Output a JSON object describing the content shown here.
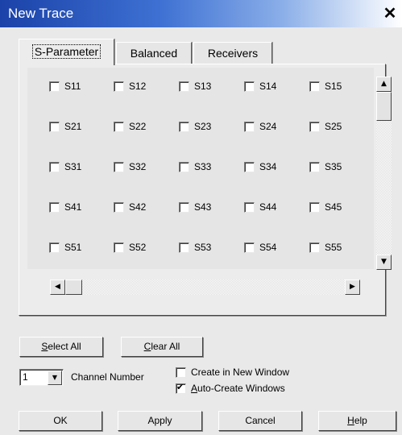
{
  "window": {
    "title": "New Trace",
    "close_glyph": "✕"
  },
  "tabs": [
    {
      "label": "S-Parameter",
      "active": true
    },
    {
      "label": "Balanced",
      "active": false
    },
    {
      "label": "Receivers",
      "active": false
    }
  ],
  "sparams": {
    "rows": [
      [
        {
          "label": "S11",
          "checked": false
        },
        {
          "label": "S12",
          "checked": false
        },
        {
          "label": "S13",
          "checked": false
        },
        {
          "label": "S14",
          "checked": false
        },
        {
          "label": "S15",
          "checked": false
        }
      ],
      [
        {
          "label": "S21",
          "checked": false
        },
        {
          "label": "S22",
          "checked": false
        },
        {
          "label": "S23",
          "checked": false
        },
        {
          "label": "S24",
          "checked": false
        },
        {
          "label": "S25",
          "checked": false
        }
      ],
      [
        {
          "label": "S31",
          "checked": false
        },
        {
          "label": "S32",
          "checked": false
        },
        {
          "label": "S33",
          "checked": false
        },
        {
          "label": "S34",
          "checked": false
        },
        {
          "label": "S35",
          "checked": false
        }
      ],
      [
        {
          "label": "S41",
          "checked": false
        },
        {
          "label": "S42",
          "checked": false
        },
        {
          "label": "S43",
          "checked": false
        },
        {
          "label": "S44",
          "checked": false
        },
        {
          "label": "S45",
          "checked": false
        }
      ],
      [
        {
          "label": "S51",
          "checked": false
        },
        {
          "label": "S52",
          "checked": false
        },
        {
          "label": "S53",
          "checked": false
        },
        {
          "label": "S54",
          "checked": false
        },
        {
          "label": "S55",
          "checked": false
        }
      ]
    ]
  },
  "scroll": {
    "up_glyph": "▲",
    "down_glyph": "▼",
    "left_glyph": "◀",
    "right_glyph": "▶"
  },
  "actions": {
    "select_all": {
      "mnemonic": "S",
      "rest": "elect All"
    },
    "clear_all": {
      "mnemonic": "C",
      "rest": "lear All"
    }
  },
  "channel": {
    "value": "1",
    "label": "Channel Number",
    "arrow_glyph": "▼"
  },
  "options": {
    "create_new_window": {
      "label": "Create in New Window",
      "checked": false
    },
    "auto_create": {
      "mnemonic": "A",
      "rest": "uto-Create Windows",
      "checked": true
    }
  },
  "buttons": {
    "ok": "OK",
    "apply": "Apply",
    "cancel": "Cancel",
    "help": {
      "mnemonic": "H",
      "rest": "elp"
    }
  }
}
